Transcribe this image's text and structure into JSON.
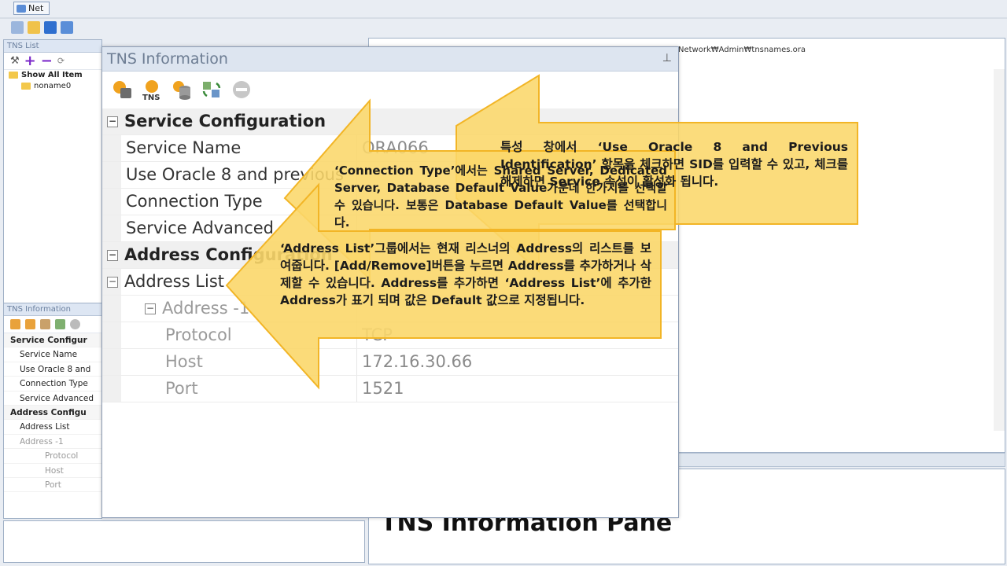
{
  "app": {
    "tab_label": "Net",
    "tns_list_title": "TNS List",
    "tree_root": "Show All Item",
    "tree_child": "noname0",
    "mini_info_title": "TNS Information",
    "path_fragment": "Network₩Admin₩tnsnames.ora",
    "pane_label": "TNS Information Pane"
  },
  "mini_props": [
    {
      "label": "Service Configur",
      "kind": "cat"
    },
    {
      "label": "Service Name",
      "kind": "prop"
    },
    {
      "label": "Use Oracle 8 and",
      "kind": "prop"
    },
    {
      "label": "Connection Type",
      "kind": "prop"
    },
    {
      "label": "Service Advanced",
      "kind": "prop"
    },
    {
      "label": "Address Configu",
      "kind": "cat"
    },
    {
      "label": "Address List",
      "kind": "prop"
    },
    {
      "label": "Address -1",
      "kind": "sub"
    },
    {
      "label": "Protocol",
      "kind": "leaf"
    },
    {
      "label": "Host",
      "kind": "leaf"
    },
    {
      "label": "Port",
      "kind": "leaf"
    }
  ],
  "dialog": {
    "title": "TNS Information",
    "pin_glyph": "⊥"
  },
  "grid": {
    "service_configuration": "Service Configuration",
    "service_name": "Service Name",
    "service_name_value": "ORA066",
    "use_oracle8": "Use Oracle 8 and previous",
    "connection_type": "Connection Type",
    "service_advanced": "Service Advanced",
    "address_configuration": "Address Configuration",
    "address_list": "Address List",
    "address_1": "Address -1",
    "protocol": "Protocol",
    "protocol_value": "TCP",
    "host": "Host",
    "host_value": "172.16.30.66",
    "port": "Port",
    "port_value": "1521"
  },
  "callouts": {
    "top_right": "특성 창에서 ‘Use Oracle 8 and Previous Identification’ 항목을 체크하면 SID를 입력할 수 있고, 체크를 해제하면 Service 속성이 활성화 됩니다.",
    "middle": "‘Connection Type’에서는 Shared Server, Dedicated Server, Database Default Value가운데 한가지를 선택할 수 있습니다. 보통은 Database Default Value를 선택합니다.",
    "bottom": "‘Address List’그룹에서는 현재 리스너의 Address의 리스트를 보여줍니다. [Add/Remove]버튼을 누르면 Address를 추가하거나 삭제할 수 있습니다. Address를 추가하면 ‘Address List’에 추가한 Address가 표기 되며 값은 Default 값으로 지정됩니다."
  },
  "colors": {
    "callout_fill": "#fbd76a",
    "callout_edge": "#f2b526",
    "accent_blue": "#3a6fc4"
  }
}
